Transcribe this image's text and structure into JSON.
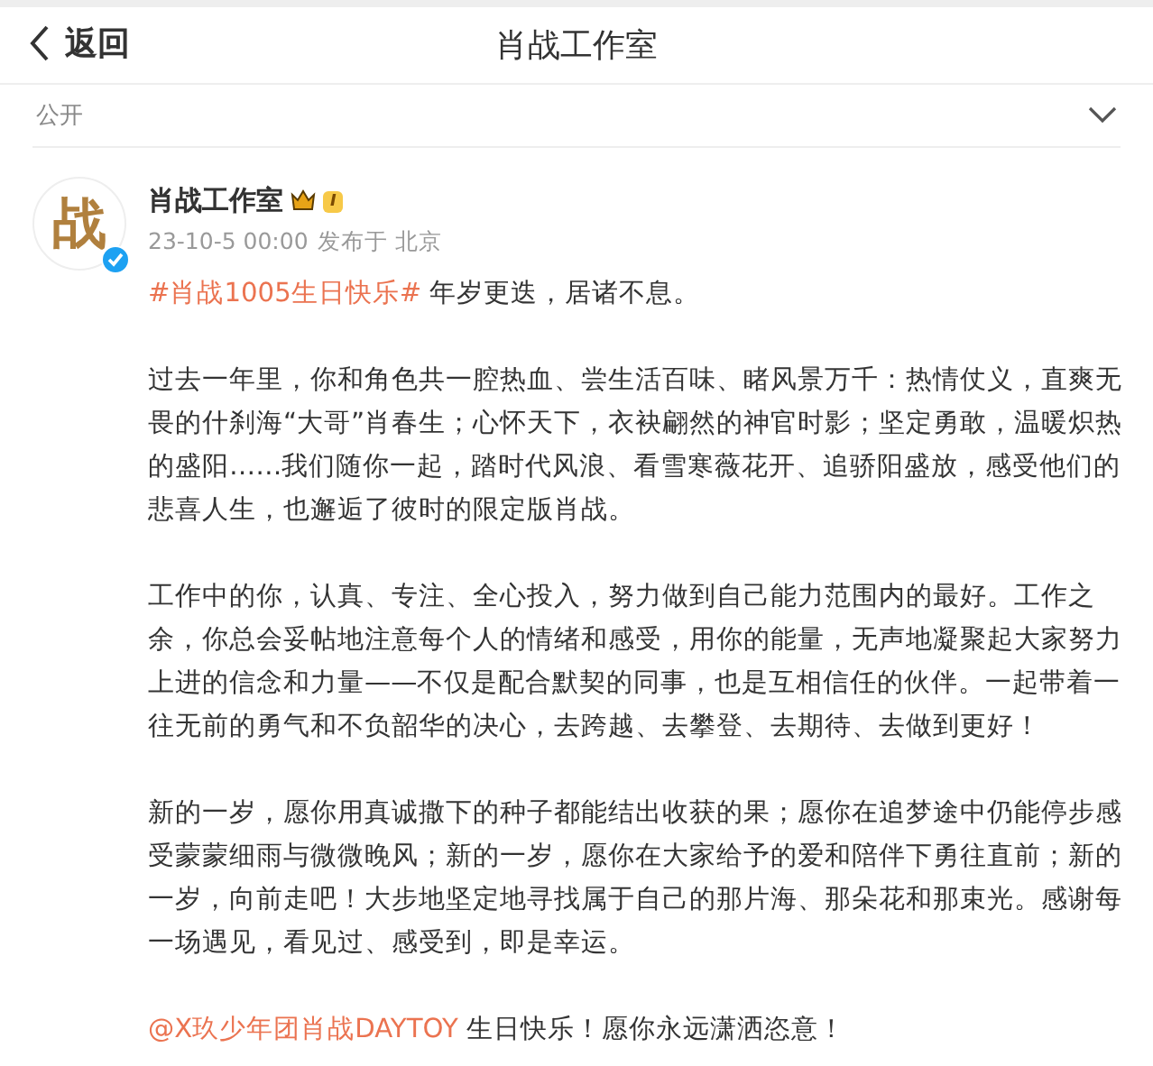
{
  "header": {
    "back_label": "返回",
    "title": "肖战工作室"
  },
  "visibility": {
    "label": "公开",
    "expanded": false
  },
  "post": {
    "avatar_logo": "战",
    "verified": true,
    "author": "肖战工作室",
    "member_level": "I",
    "time": "23-10-5 00:00",
    "location": "发布于 北京",
    "paragraphs": [
      [
        {
          "kind": "tag",
          "text": "#肖战1005生日快乐#"
        },
        {
          "kind": "text",
          "text": " 年岁更迭，居诸不息。"
        }
      ],
      [
        {
          "kind": "text",
          "text": "过去一年里，你和角色共一腔热血、尝生活百味、睹风景万千：热情仗义，直爽无畏的什刹海“大哥”肖春生；心怀天下，衣袂翩然的神官时影；坚定勇敢，温暖炽热的盛阳……我们随你一起，踏时代风浪、看雪寒薇花开、追骄阳盛放，感受他们的悲喜人生，也邂逅了彼时的限定版肖战。"
        }
      ],
      [
        {
          "kind": "text",
          "text": "工作中的你，认真、专注、全心投入，努力做到自己能力范围内的最好。工作之余，你总会妥帖地注意每个人的情绪和感受，用你的能量，无声地凝聚起大家努力上进的信念和力量——不仅是配合默契的同事，也是互相信任的伙伴。一起带着一往无前的勇气和不负韶华的决心，去跨越、去攀登、去期待、去做到更好！"
        }
      ],
      [
        {
          "kind": "text",
          "text": "新的一岁，愿你用真诚撒下的种子都能结出收获的果；愿你在追梦途中仍能停步感受蒙蒙细雨与微微晚风；新的一岁，愿你在大家给予的爱和陪伴下勇往直前；新的一岁，向前走吧！大步地坚定地寻找属于自己的那片海、那朵花和那束光。感谢每一场遇见，看见过、感受到，即是幸运。"
        }
      ],
      [
        {
          "kind": "mention",
          "text": "@X玖少年团肖战DAYTOY"
        },
        {
          "kind": "text",
          "text": " 生日快乐！愿你永远潇洒恣意！"
        }
      ]
    ]
  }
}
